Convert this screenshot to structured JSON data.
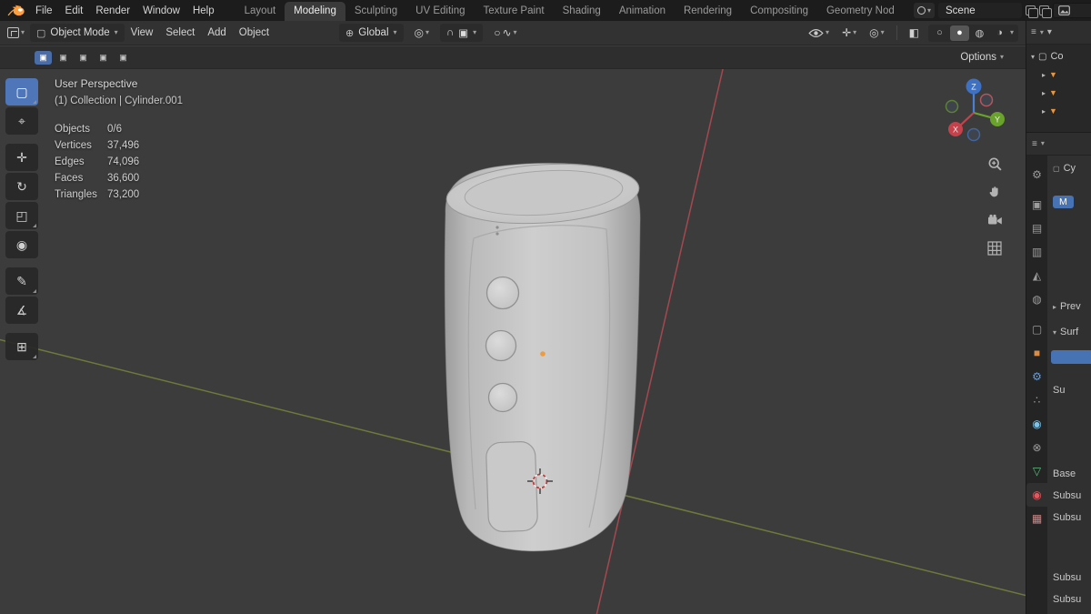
{
  "topbar": {
    "menus": [
      "File",
      "Edit",
      "Render",
      "Window",
      "Help"
    ],
    "tabs": [
      "Layout",
      "Modeling",
      "Sculpting",
      "UV Editing",
      "Texture Paint",
      "Shading",
      "Animation",
      "Rendering",
      "Compositing",
      "Geometry Nod"
    ],
    "active_tab": "Modeling",
    "scene_field": "Scene"
  },
  "viewport_header": {
    "mode_selector": "Object Mode",
    "menus": [
      "View",
      "Select",
      "Add",
      "Object"
    ],
    "orientation": "Global"
  },
  "tool_settings": {
    "options_label": "Options"
  },
  "viewport": {
    "view_label": "User Perspective",
    "context_label": "(1) Collection | Cylinder.001",
    "stats": [
      {
        "label": "Objects",
        "value": "0/6"
      },
      {
        "label": "Vertices",
        "value": "37,496"
      },
      {
        "label": "Edges",
        "value": "74,096"
      },
      {
        "label": "Faces",
        "value": "36,600"
      },
      {
        "label": "Triangles",
        "value": "73,200"
      }
    ],
    "gizmo_axes": {
      "x": "X",
      "y": "Y",
      "z": "Z"
    }
  },
  "outliner": {
    "root_label": "Co"
  },
  "properties": {
    "breadcrumb_label": "Cy",
    "material_slot_label": "M",
    "preview_section": "Prev",
    "surface_section": "Surf",
    "surface_partial": "Su",
    "fields": [
      "Base",
      "Subsu",
      "Subsu",
      "Subsu",
      "Subsu"
    ]
  },
  "icons": {
    "chevron": "▾",
    "select_tool": "▢",
    "cursor_tool": "⌖",
    "move_tool": "✛",
    "rotate_tool": "↻",
    "scale_tool": "◰",
    "transform_tool": "◉",
    "annotate_tool": "✎",
    "measure_tool": "∡",
    "add_cube_tool": "⊞",
    "globe": "⊕",
    "pivot": "◎",
    "magnet": "∩",
    "snap_target": "▣",
    "proportional": "○",
    "falloff": "∿",
    "gizmo_toggle": "✛",
    "overlays_toggle": "◎",
    "xray": "◧",
    "shade_wireframe": "○",
    "shade_solid": "●",
    "shade_material": "◍",
    "shade_rendered": "◑",
    "menu_grid": "≡",
    "tri_down": "▾",
    "tri_right": "▸",
    "tri_orange": "▼",
    "box": "▢",
    "select_mode": "▣",
    "ptab_tool": "⚙",
    "ptab_render": "▣",
    "ptab_output": "▤",
    "ptab_viewlayer": "▥",
    "ptab_scene": "◭",
    "ptab_world": "◍",
    "ptab_collection": "▢",
    "ptab_object": "■",
    "ptab_modifiers": "⚙",
    "ptab_particles": "∴",
    "ptab_physics": "◉",
    "ptab_constraints": "⊗",
    "ptab_data": "▽",
    "ptab_material": "◉",
    "ptab_texture": "▦"
  },
  "colors": {
    "accent_blue": "#4772b3",
    "active_tool_blue": "#4f76b8",
    "axis_x_red": "#b04a52",
    "axis_y_green": "#75803a",
    "object_origin_orange": "#ee9b3f",
    "outliner_orange": "#e8963f",
    "material_tab_red": "#e4575f"
  }
}
